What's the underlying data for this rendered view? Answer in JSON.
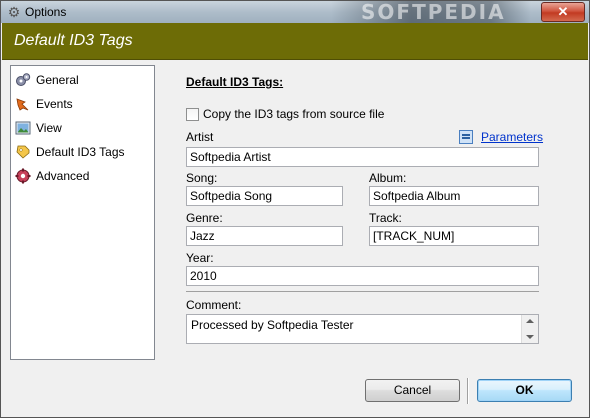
{
  "window": {
    "title": "Options",
    "close_glyph": "✕",
    "watermark": "SOFTPEDIA"
  },
  "header": {
    "title": "Default ID3 Tags"
  },
  "nav": {
    "items": [
      {
        "label": "General",
        "icon": "gears-icon"
      },
      {
        "label": "Events",
        "icon": "events-icon"
      },
      {
        "label": "View",
        "icon": "view-icon"
      },
      {
        "label": "Default ID3 Tags",
        "icon": "tags-icon",
        "selected": true
      },
      {
        "label": "Advanced",
        "icon": "advanced-icon"
      }
    ]
  },
  "form": {
    "section_title": "Default ID3 Tags:",
    "copy_checkbox_label": "Copy the ID3 tags from source file",
    "copy_checked": false,
    "parameters_link": "Parameters",
    "artist_label": "Artist",
    "artist_value": "Softpedia Artist",
    "song_label": "Song:",
    "song_value": "Softpedia Song",
    "album_label": "Album:",
    "album_value": "Softpedia Album",
    "genre_label": "Genre:",
    "genre_value": "Jazz",
    "track_label": "Track:",
    "track_value": "[TRACK_NUM]",
    "year_label": "Year:",
    "year_value": "2010",
    "comment_label": "Comment:",
    "comment_value": "Processed by Softpedia Tester"
  },
  "buttons": {
    "cancel": "Cancel",
    "ok": "OK"
  },
  "colors": {
    "header_bg": "#6d6c06",
    "link": "#0033cc",
    "ok_border": "#3c7fb1"
  }
}
